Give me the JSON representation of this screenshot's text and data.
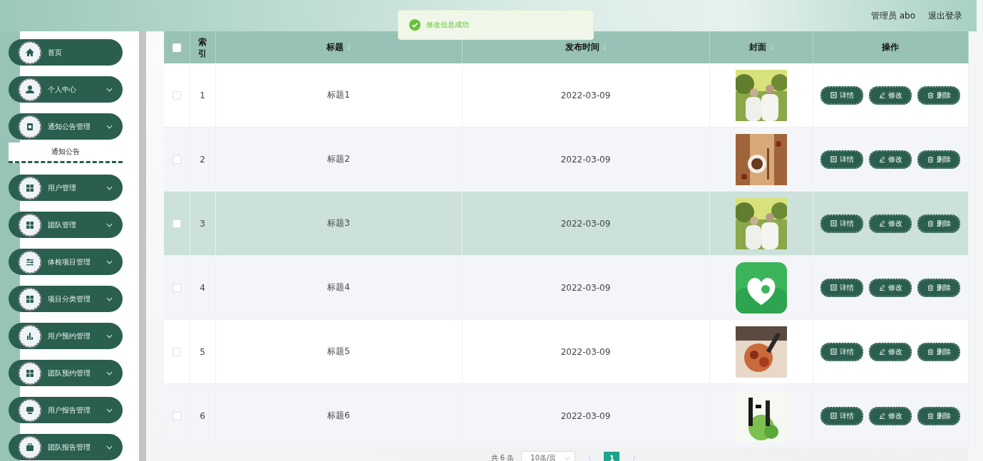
{
  "header": {
    "user": "管理员 abo",
    "logout": "退出登录"
  },
  "toast": {
    "message": "修改信息成功"
  },
  "sidebar": {
    "items": [
      {
        "kind": "link",
        "label": "首页"
      },
      {
        "kind": "submenu",
        "label": "个人中心"
      },
      {
        "kind": "submenu",
        "label": "通知公告管理",
        "expanded": true,
        "children": [
          {
            "label": "通知公告"
          }
        ]
      },
      {
        "kind": "submenu",
        "label": "用户管理"
      },
      {
        "kind": "submenu",
        "label": "团队管理"
      },
      {
        "kind": "submenu",
        "label": "体检项目管理"
      },
      {
        "kind": "submenu",
        "label": "项目分类管理"
      },
      {
        "kind": "submenu",
        "label": "用户预约管理"
      },
      {
        "kind": "submenu",
        "label": "团队预约管理"
      },
      {
        "kind": "submenu",
        "label": "用户报告管理"
      },
      {
        "kind": "submenu",
        "label": "团队报告管理"
      }
    ]
  },
  "table": {
    "columns": [
      {
        "kind": "check",
        "checked": false
      },
      {
        "kind": "text",
        "label": "索引",
        "sortable": false
      },
      {
        "kind": "text",
        "label": "标题",
        "sortable": true
      },
      {
        "kind": "text",
        "label": "发布时间",
        "sortable": true
      },
      {
        "kind": "text",
        "label": "封面",
        "sortable": true
      },
      {
        "kind": "text",
        "label": "操作",
        "sortable": false
      }
    ],
    "rows": [
      {
        "index": "1",
        "title": "标题1",
        "date": "2022-03-09",
        "checked": false,
        "selected": false,
        "actions": [
          {
            "kind": "detail",
            "label": "详情"
          },
          {
            "kind": "edit",
            "label": "修改"
          },
          {
            "kind": "delete",
            "label": "删除"
          }
        ]
      },
      {
        "index": "2",
        "title": "标题2",
        "date": "2022-03-09",
        "checked": false,
        "selected": false,
        "actions": [
          {
            "kind": "detail",
            "label": "详情"
          },
          {
            "kind": "edit",
            "label": "修改"
          },
          {
            "kind": "delete",
            "label": "删除"
          }
        ]
      },
      {
        "index": "3",
        "title": "标题3",
        "date": "2022-03-09",
        "checked": false,
        "selected": true,
        "actions": [
          {
            "kind": "detail",
            "label": "详情"
          },
          {
            "kind": "edit",
            "label": "修改"
          },
          {
            "kind": "delete",
            "label": "删除"
          }
        ]
      },
      {
        "index": "4",
        "title": "标题4",
        "date": "2022-03-09",
        "checked": false,
        "selected": false,
        "actions": [
          {
            "kind": "detail",
            "label": "详情"
          },
          {
            "kind": "edit",
            "label": "修改"
          },
          {
            "kind": "delete",
            "label": "删除"
          }
        ]
      },
      {
        "index": "5",
        "title": "标题5",
        "date": "2022-03-09",
        "checked": false,
        "selected": false,
        "actions": [
          {
            "kind": "detail",
            "label": "详情"
          },
          {
            "kind": "edit",
            "label": "修改"
          },
          {
            "kind": "delete",
            "label": "删除"
          }
        ]
      },
      {
        "index": "6",
        "title": "标题6",
        "date": "2022-03-09",
        "checked": false,
        "selected": false,
        "actions": [
          {
            "kind": "detail",
            "label": "详情"
          },
          {
            "kind": "edit",
            "label": "修改"
          },
          {
            "kind": "delete",
            "label": "删除"
          }
        ]
      }
    ]
  },
  "pagination": {
    "total": "共 6 条",
    "page_size": "10条/页",
    "pages": [
      {
        "label": "1",
        "selected": true
      }
    ]
  }
}
